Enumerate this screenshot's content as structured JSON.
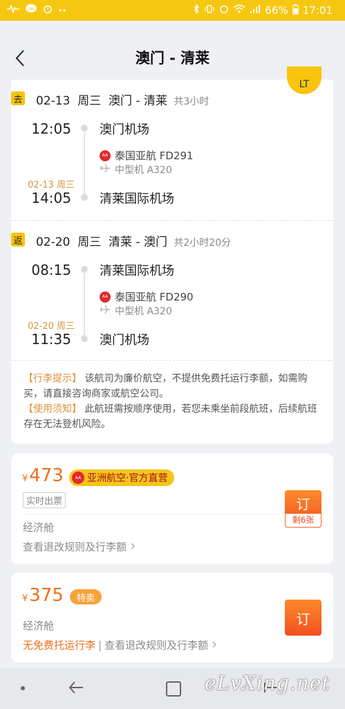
{
  "status_bar": {
    "battery": "66%",
    "time": "17:01",
    "left_icons": [
      "activity-icon",
      "line-app-icon",
      "alarm-icon",
      "more-dots-icon"
    ],
    "right_icons": [
      "bluetooth-icon",
      "vibrate-icon",
      "alarm-icon",
      "wifi-icon",
      "signal-icon",
      "battery-icon"
    ]
  },
  "header": {
    "title": "澳门 - 清莱",
    "partial_badge": "LT"
  },
  "outbound": {
    "tag": "去",
    "date": "02-13",
    "weekday": "周三",
    "route": "澳门 - 清莱",
    "duration": "共3小时",
    "depart_time": "12:05",
    "depart_airport": "澳门机场",
    "airline": "泰国亚航 FD291",
    "aircraft": "中型机 A320",
    "arrive_date": "02-13 周三",
    "arrive_time": "14:05",
    "arrive_airport": "清莱国际机场"
  },
  "return": {
    "tag": "返",
    "date": "02-20",
    "weekday": "周三",
    "route": "清莱 - 澳门",
    "duration": "共2小时20分",
    "depart_time": "08:15",
    "depart_airport": "清莱国际机场",
    "airline": "泰国亚航 FD290",
    "aircraft": "中型机 A320",
    "arrive_date": "02-20 周三",
    "arrive_time": "11:35",
    "arrive_airport": "澳门机场"
  },
  "notes": {
    "baggage_label": "【行李提示】",
    "baggage_text": "该航司为廉价航空，不提供免费托运行李额，如需购买，请直接咨询商家或航空公司。",
    "usage_label": "【使用须知】",
    "usage_text": "此航班需按顺序使用，若您未乘坐前段航班，后续航班存在无法登机风险。"
  },
  "offers": [
    {
      "currency": "¥",
      "price": "473",
      "brand": "亚洲航空·官方直营",
      "badge": "实时出票",
      "cabin": "经济舱",
      "rules": "查看退改规则及行李额",
      "book": "订",
      "remaining": "剩6张"
    },
    {
      "currency": "¥",
      "price": "375",
      "special": "特卖",
      "cabin": "经济舱",
      "free_bag": "无免费托运行李",
      "rules": "查看退改规则及行李额",
      "book": "订"
    }
  ],
  "watermark": "eLvXing.net",
  "colors": {
    "status_yellow": "#f6c710",
    "price_orange": "#ee6f1a",
    "note_orange": "#e0903a"
  }
}
